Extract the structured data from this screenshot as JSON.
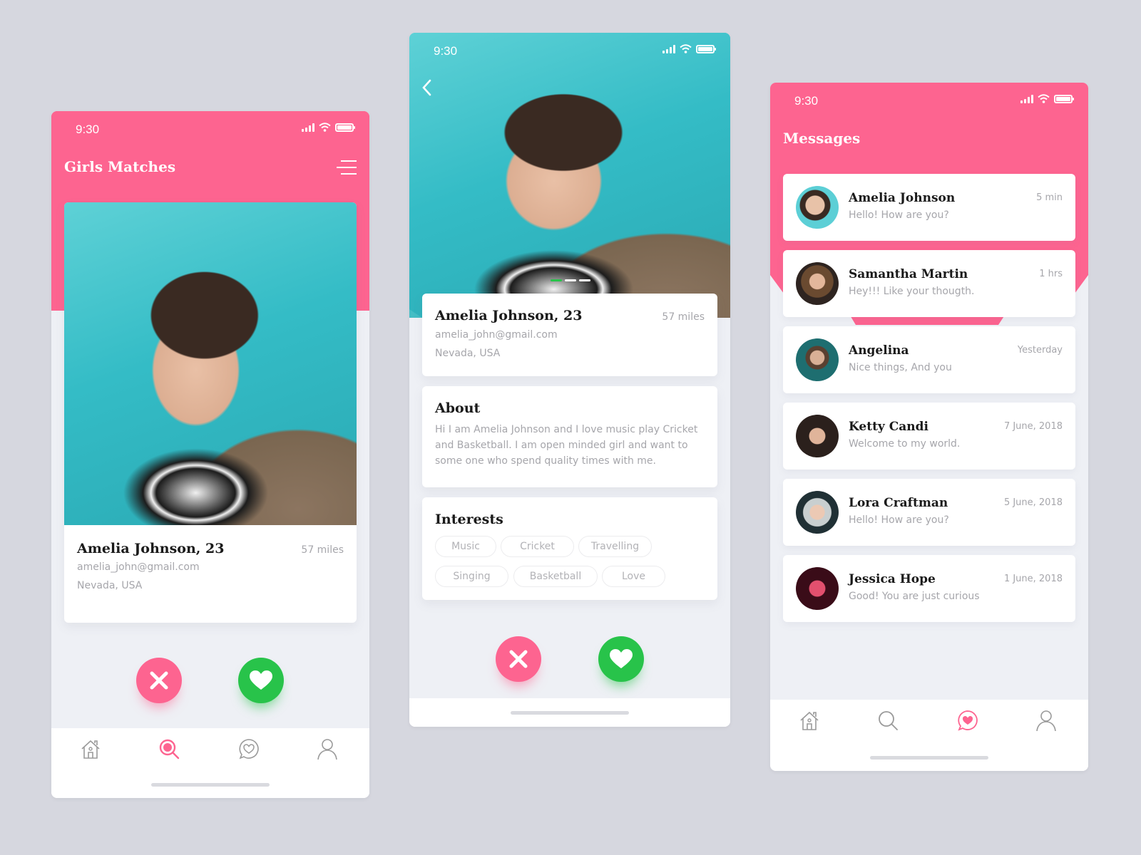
{
  "colors": {
    "accent": "#fd6490",
    "like": "#28c34a",
    "background": "#d6d7df"
  },
  "screen1": {
    "status_time": "9:30",
    "title": "Girls Matches",
    "menu_icon": "menu-icon",
    "profile": {
      "name": "Amelia Johnson, 23",
      "distance": "57 miles",
      "email": "amelia_john@gmail.com",
      "location": "Nevada, USA"
    },
    "actions": {
      "dislike_icon": "close-icon",
      "like_icon": "heart-icon"
    },
    "tabs": [
      {
        "name": "home",
        "icon": "home-icon",
        "active": false
      },
      {
        "name": "search",
        "icon": "search-icon",
        "active": true
      },
      {
        "name": "messages",
        "icon": "chat-heart-icon",
        "active": false
      },
      {
        "name": "profile",
        "icon": "user-icon",
        "active": false
      }
    ]
  },
  "screen2": {
    "status_time": "9:30",
    "back_icon": "chevron-left-icon",
    "carousel": {
      "pages": 3,
      "active": 1
    },
    "profile": {
      "name": "Amelia Johnson, 23",
      "distance": "57 miles",
      "email": "amelia_john@gmail.com",
      "location": "Nevada, USA"
    },
    "about": {
      "heading": "About",
      "text": "Hi I am Amelia Johnson and I love music play Cricket and Basketball. I am open minded girl and want to some one who spend quality times with me."
    },
    "interests": {
      "heading": "Interests",
      "items": [
        "Music",
        "Cricket",
        "Travelling",
        "Singing",
        "Basketball",
        "Love"
      ]
    }
  },
  "screen3": {
    "status_time": "9:30",
    "title": "Messages",
    "messages": [
      {
        "name": "Amelia Johnson",
        "text": "Hello! How are you?",
        "time": "5 min"
      },
      {
        "name": "Samantha Martin",
        "text": "Hey!!! Like your thougth.",
        "time": "1 hrs"
      },
      {
        "name": "Angelina",
        "text": "Nice things, And you",
        "time": "Yesterday"
      },
      {
        "name": "Ketty Candi",
        "text": "Welcome to my world.",
        "time": "7 June, 2018"
      },
      {
        "name": "Lora Craftman",
        "text": "Hello! How are you?",
        "time": "5 June, 2018"
      },
      {
        "name": "Jessica Hope",
        "text": "Good! You are just curious",
        "time": "1 June, 2018"
      }
    ],
    "tabs": [
      {
        "name": "home",
        "icon": "home-icon",
        "active": false
      },
      {
        "name": "search",
        "icon": "search-icon",
        "active": false
      },
      {
        "name": "messages",
        "icon": "chat-heart-icon",
        "active": true
      },
      {
        "name": "profile",
        "icon": "user-icon",
        "active": false
      }
    ]
  }
}
